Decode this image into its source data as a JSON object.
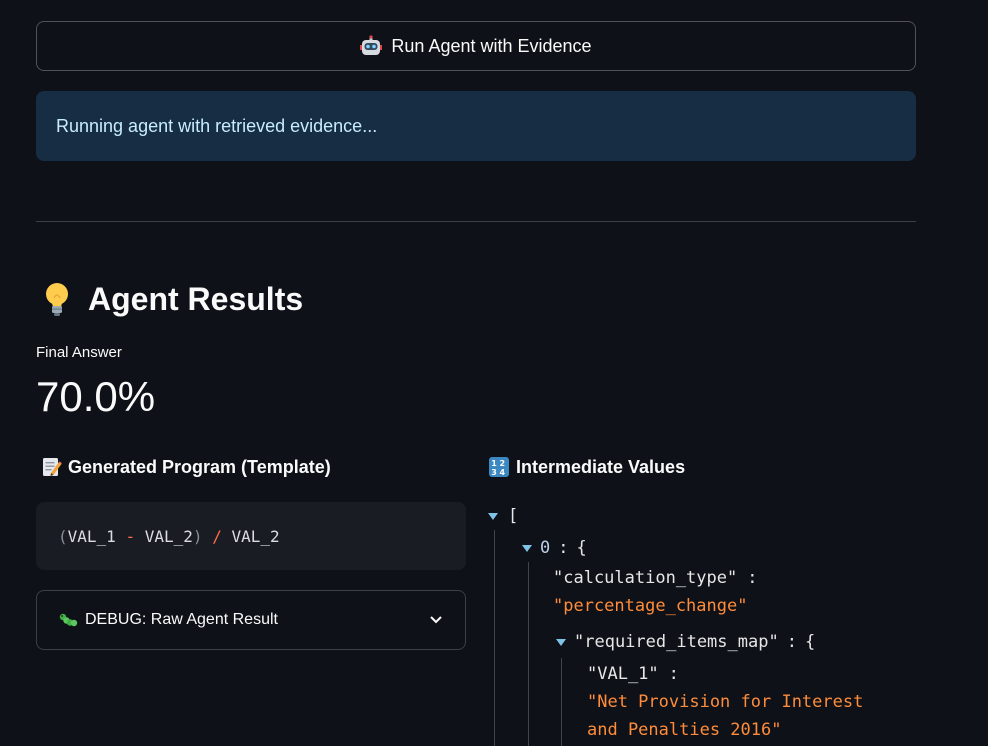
{
  "run_button": {
    "label": "Run Agent with Evidence",
    "icon": "robot-icon"
  },
  "info": {
    "text": "Running agent with retrieved evidence..."
  },
  "results": {
    "title": "Agent Results",
    "icon": "lightbulb-icon"
  },
  "metric": {
    "label": "Final Answer",
    "value": "70.0%"
  },
  "program": {
    "heading": "Generated Program (Template)",
    "icon": "memo-icon",
    "code": {
      "open": "(",
      "var1": "VAL_1",
      "minus": "-",
      "var2": "VAL_2",
      "close": ")",
      "div": "/",
      "var3": "VAL_2"
    }
  },
  "debug": {
    "label": "DEBUG: Raw Agent Result",
    "icon": "caterpillar-icon"
  },
  "intermediate": {
    "heading": "Intermediate Values",
    "icon": "numbers-icon",
    "open_bracket": "[",
    "index": "0",
    "colon": ":",
    "open_brace": "{",
    "calc_key": "\"calculation_type\"",
    "calc_value": "\"percentage_change\"",
    "map_key": "\"required_items_map\"",
    "val1_key": "\"VAL_1\"",
    "val1_value_line1": "\"Net Provision for Interest",
    "val1_value_line2": "and Penalties 2016\""
  },
  "colors": {
    "background": "#0e1117",
    "info_bg": "#172d43",
    "info_text": "#c7ebff",
    "json_string": "#ff8c3a",
    "code_operator": "#ff6b4a"
  }
}
